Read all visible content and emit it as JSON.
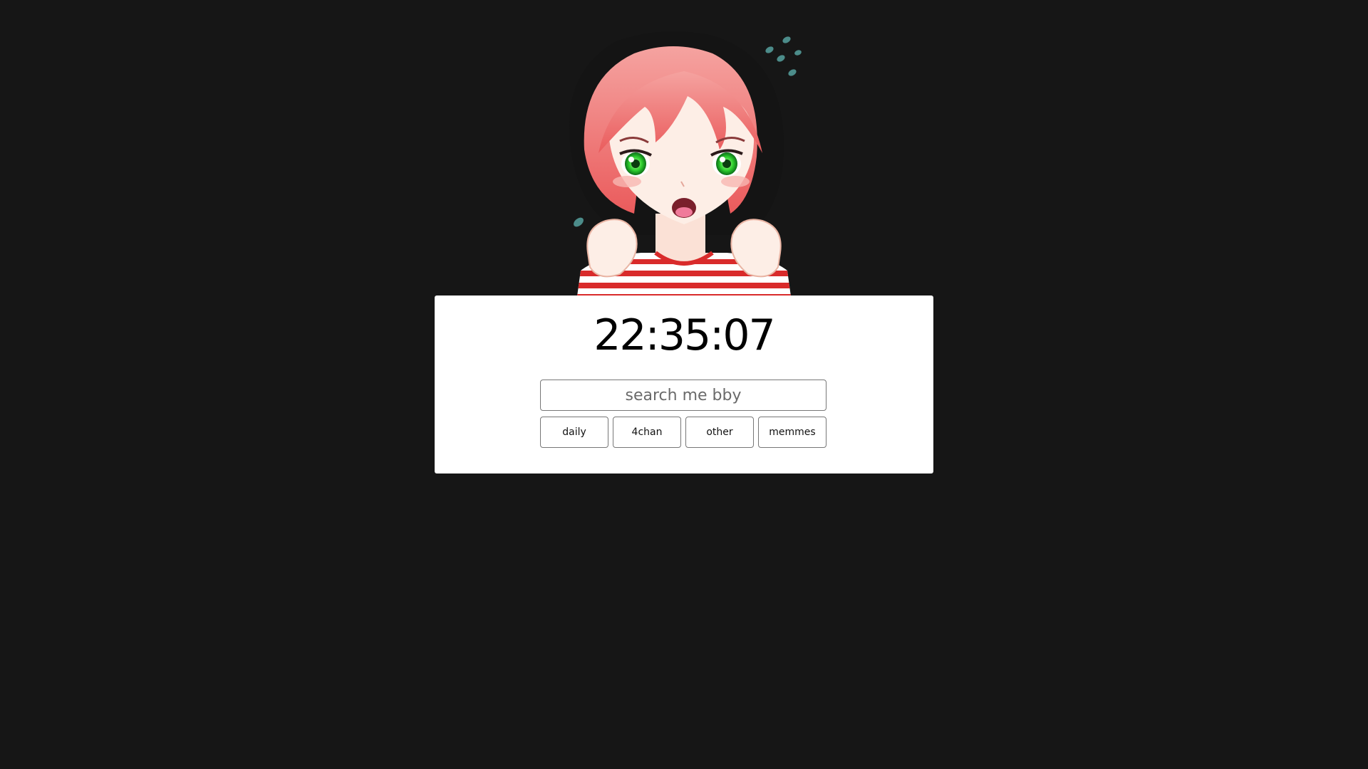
{
  "clock": {
    "time": "22:35:07"
  },
  "search": {
    "placeholder": "search me bby"
  },
  "links": [
    {
      "label": "daily"
    },
    {
      "label": "4chan"
    },
    {
      "label": "other"
    },
    {
      "label": "memmes"
    }
  ],
  "mascot": {
    "icon": "anime-girl-illustration"
  },
  "colors": {
    "background": "#161616",
    "card": "#ffffff",
    "hair": "#f07a78",
    "hair_back": "#111111",
    "eyes": "#33cc33",
    "shirt_stripe": "#d92b2b"
  }
}
